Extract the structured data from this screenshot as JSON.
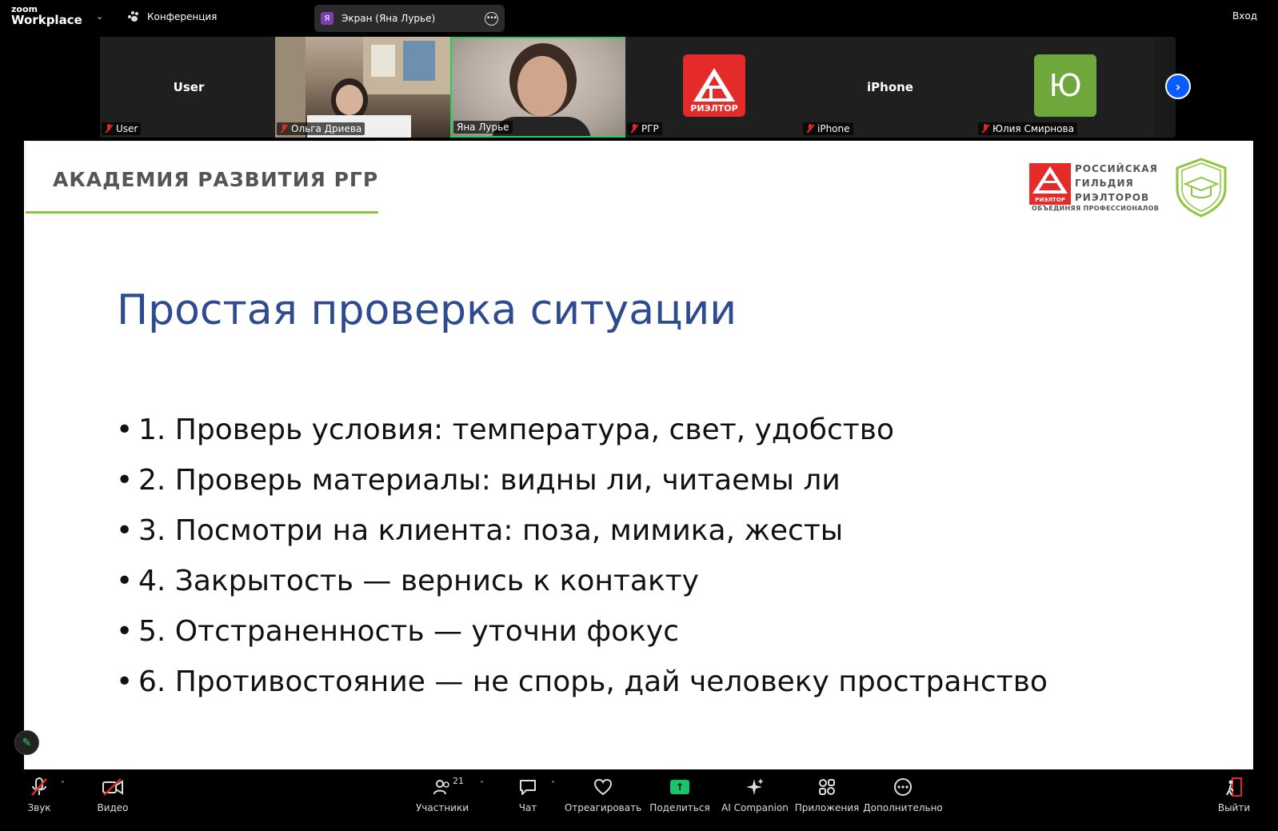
{
  "topbar": {
    "logo_small": "zoom",
    "logo_big": "Workplace",
    "meeting_label": "Конференция",
    "screen_badge": "Я",
    "screen_title": "Экран (Яна Лурье)",
    "login": "Вход"
  },
  "participants": [
    {
      "display": "User",
      "label": "User",
      "muted": true
    },
    {
      "display": "",
      "label": "Ольга Дриева",
      "muted": true
    },
    {
      "display": "",
      "label": "Яна Лурье",
      "muted": false
    },
    {
      "display": "",
      "label": "РГР",
      "muted": true,
      "logo_text": "РИЭЛТОР"
    },
    {
      "display": "iPhone",
      "label": "iPhone",
      "muted": true
    },
    {
      "display": "",
      "label": "Юлия Смирнова",
      "muted": true,
      "avatar_letter": "Ю"
    }
  ],
  "slide": {
    "academy": "АКАДЕМИЯ РАЗВИТИЯ РГР",
    "guild_line1": "РОССИЙСКАЯ",
    "guild_line2": "ГИЛЬДИЯ",
    "guild_line3": "РИЭЛТОРОВ",
    "guild_sub": "ОБЪЕДИНЯЯ ПРОФЕССИОНАЛОВ",
    "guild_logo_text": "РИЭЛТОР",
    "title": "Простая проверка ситуации",
    "bullets": [
      "1. Проверь условия: температура, свет, удобство",
      "2. Проверь материалы: видны ли, читаемы ли",
      "3. Посмотри на клиента: поза, мимика, жесты",
      "4. Закрытость — вернись к контакту",
      "5. Отстраненность — уточни фокус",
      "6. Противостояние — не спорь, дай человеку пространство"
    ]
  },
  "toolbar": {
    "audio": "Звук",
    "video": "Видео",
    "participants": "Участники",
    "participants_count": "21",
    "chat": "Чат",
    "react": "Отреагировать",
    "share": "Поделиться",
    "ai": "AI Companion",
    "apps": "Приложения",
    "more": "Дополнительно",
    "leave": "Выйти"
  },
  "colors": {
    "accent_green": "#23d05e",
    "brand_red": "#e52a2a",
    "title_blue": "#2f4b8f",
    "rule_green": "#8dc63f",
    "avatar_green": "#6ea83c",
    "next_blue": "#0b5cff"
  }
}
